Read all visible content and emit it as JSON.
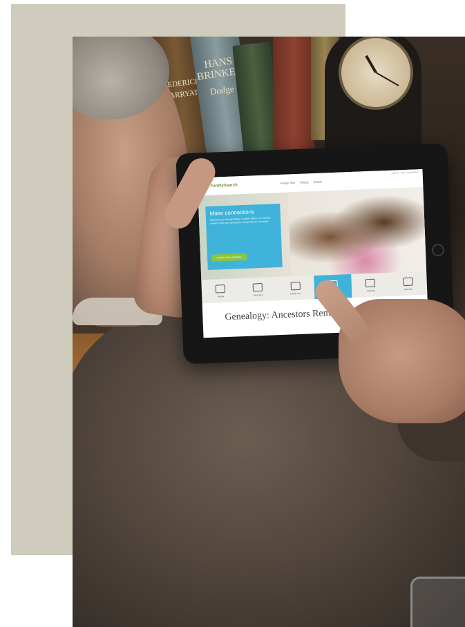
{
  "book_spines": {
    "book1": "FREDERICK MARRYAT",
    "book2_line1": "HANS",
    "book2_line2": "BRINKER",
    "book2_author": "Dodge"
  },
  "tablet": {
    "site": {
      "logo": "FamilySearch",
      "nav": [
        "Family Tree",
        "Photos",
        "Search"
      ],
      "top_links": "Sign In · Help · Get Involved",
      "hero_title": "Make connections",
      "hero_body": "Discover your family history. Explore billions of records, connect with your ancestors, and preserve memories.",
      "hero_button": "Create a free account",
      "icons": [
        "Temple",
        "Memories",
        "Family Tree",
        "Search",
        "Indexing",
        "Get Help"
      ],
      "active_icon_index": 3
    },
    "page_heading": "Genealogy: Ancestors Rem"
  },
  "colors": {
    "beige_panel": "#cfccbd",
    "site_accent_blue": "#3fb3d9",
    "site_accent_green": "#8cc63f"
  }
}
